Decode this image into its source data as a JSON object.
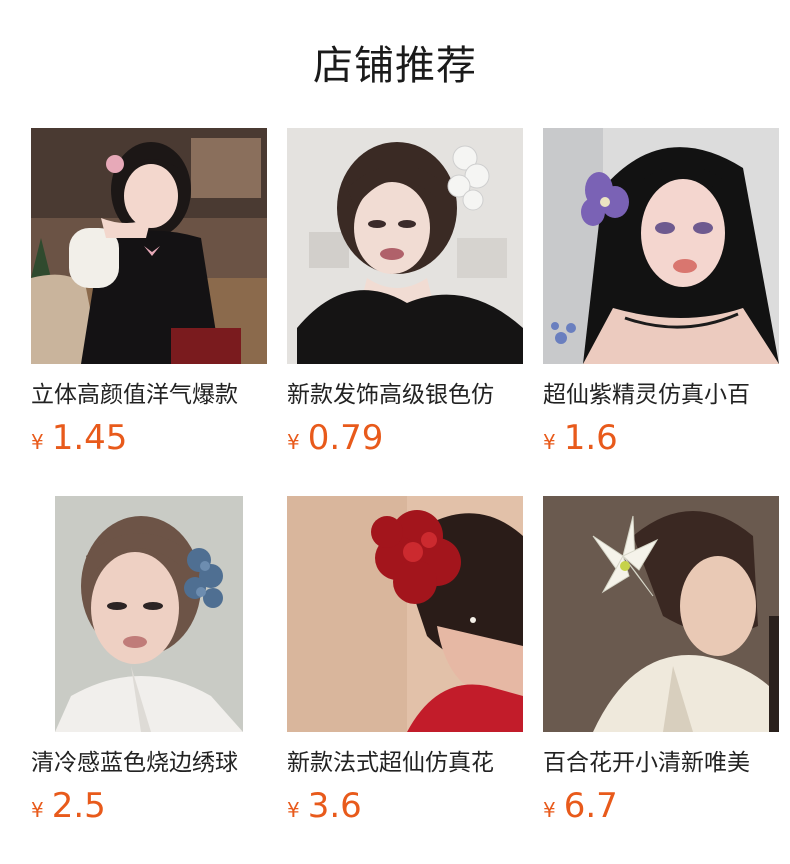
{
  "title": "店铺推荐",
  "currency_symbol": "¥",
  "accent_color": "#e85a1b",
  "products": [
    {
      "name": "立体高颜值洋气爆款",
      "price": "1.45",
      "image": "girl-pink-flower-black-sweater-photo"
    },
    {
      "name": "新款发饰高级银色仿",
      "price": "0.79",
      "image": "girl-silver-flower-clip-photo"
    },
    {
      "name": "超仙紫精灵仿真小百",
      "price": "1.6",
      "image": "girl-purple-flower-clip-photo"
    },
    {
      "name": "清冷感蓝色烧边绣球",
      "price": "2.5",
      "image": "girl-blue-hydrangea-clip-photo"
    },
    {
      "name": "新款法式超仙仿真花",
      "price": "3.6",
      "image": "girl-red-flower-clip-photo"
    },
    {
      "name": "百合花开小清新唯美",
      "price": "6.7",
      "image": "girl-white-lily-clip-photo"
    }
  ]
}
